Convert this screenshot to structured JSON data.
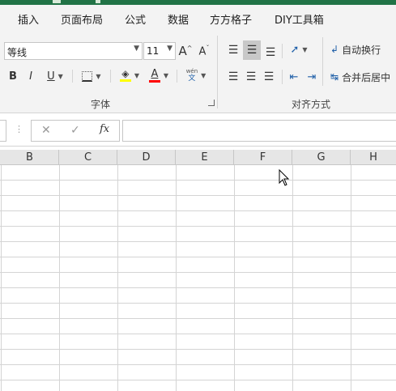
{
  "ribbon_tabs": [
    "插入",
    "页面布局",
    "公式",
    "数据",
    "方方格子",
    "DIY工具箱"
  ],
  "font": {
    "name": "等线",
    "size": "11",
    "grow_label": "A",
    "shrink_label": "A",
    "bold": "B",
    "italic": "I",
    "underline": "U",
    "font_color_label": "A",
    "phonetic_top": "wén",
    "phonetic_bottom": "文",
    "group_label": "字体",
    "fill_color": "#ffff00",
    "font_color": "#ff0000"
  },
  "alignment": {
    "wrap_text_label": "自动换行",
    "merge_center_label": "合并后居中",
    "group_label": "对齐方式"
  },
  "formula_bar": {
    "cancel": "✕",
    "enter": "✓",
    "fx": "fx",
    "value": ""
  },
  "columns": [
    "B",
    "C",
    "D",
    "E",
    "F",
    "G",
    "H"
  ],
  "colors": {
    "excel_green": "#217346",
    "ribbon_bg": "#f3f3f3",
    "gridline": "#d4d4d4",
    "header_bg": "#e6e6e6"
  }
}
